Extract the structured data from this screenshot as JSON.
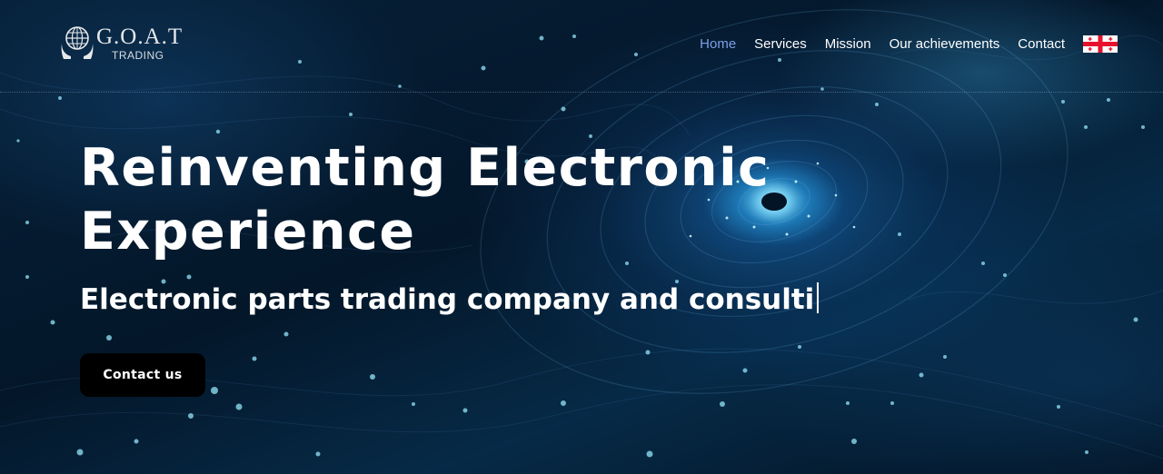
{
  "logo": {
    "title": "G.O.A.T",
    "subtitle": "TRADING",
    "emblem_icon": "globe-hands-icon"
  },
  "nav": {
    "items": [
      {
        "label": "Home",
        "active": true
      },
      {
        "label": "Services",
        "active": false
      },
      {
        "label": "Mission",
        "active": false
      },
      {
        "label": "Our achievements",
        "active": false
      },
      {
        "label": "Contact",
        "active": false
      }
    ],
    "language_flag_icon": "georgia-flag-icon",
    "active_color": "#7e9fe6"
  },
  "hero": {
    "headline_line1": "Reinventing Electronic",
    "headline_line2": "Experience",
    "typed_text": "Electronic parts trading company and consulti",
    "cta_label": "Contact us"
  },
  "colors": {
    "background": "#04172a",
    "glow": "#3fb6f0",
    "button": "#000000",
    "text": "#ffffff"
  }
}
